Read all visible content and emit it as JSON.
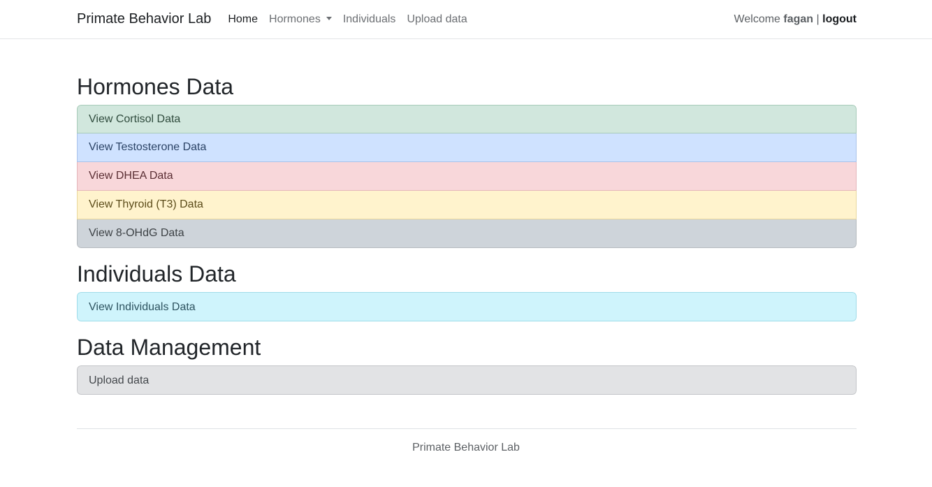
{
  "nav": {
    "brand": "Primate Behavior Lab",
    "links": {
      "home": "Home",
      "hormones": "Hormones",
      "individuals": "Individuals",
      "upload": "Upload data"
    },
    "welcome_prefix": "Welcome",
    "username": "fagan",
    "separator": "|",
    "logout": "logout"
  },
  "sections": {
    "hormones": {
      "title": "Hormones Data",
      "items": [
        "View Cortisol Data",
        "View Testosterone Data",
        "View DHEA Data",
        "View Thyroid (T3) Data",
        "View 8-OHdG Data"
      ]
    },
    "individuals": {
      "title": "Individuals Data",
      "items": [
        "View Individuals Data"
      ]
    },
    "management": {
      "title": "Data Management",
      "items": [
        "Upload data"
      ]
    }
  },
  "footer": {
    "text": "Primate Behavior Lab"
  },
  "colors": {
    "success": "#d1e7dd",
    "primary": "#cfe2ff",
    "danger": "#f8d7da",
    "warning": "#fff3cd",
    "dark": "#ced4da",
    "info": "#cff4fc",
    "secondary": "#e2e3e5"
  }
}
